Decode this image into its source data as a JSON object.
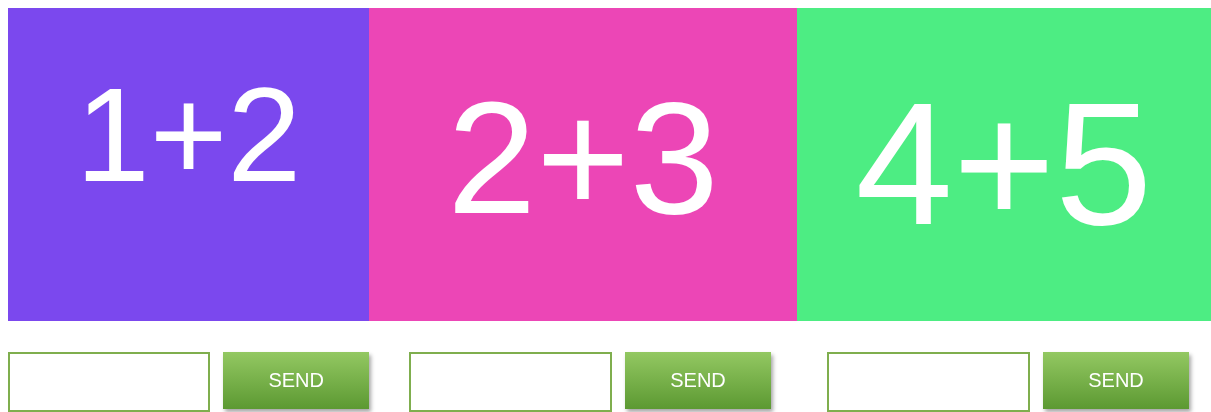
{
  "problems": [
    {
      "expression": "1+2",
      "color": "#7b48ee",
      "button": "SEND"
    },
    {
      "expression": "2+3",
      "color": "#ec46b6",
      "button": "SEND"
    },
    {
      "expression": "4+5",
      "color": "#4ded83",
      "button": "SEND"
    }
  ]
}
